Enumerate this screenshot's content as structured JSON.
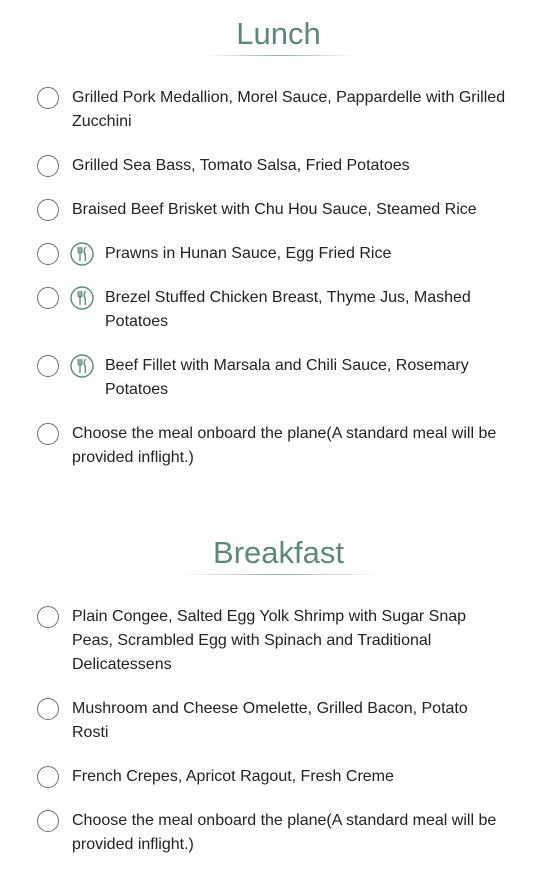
{
  "sections": [
    {
      "title": "Lunch",
      "options": [
        {
          "label": "Grilled Pork Medallion, Morel Sauce, Pappardelle with Grilled Zucchini",
          "icon": null
        },
        {
          "label": "Grilled Sea Bass, Tomato Salsa, Fried Potatoes",
          "icon": null
        },
        {
          "label": "Braised Beef Brisket with Chu Hou Sauce, Steamed Rice",
          "icon": null
        },
        {
          "label": "Prawns in Hunan Sauce, Egg Fried Rice",
          "icon": "fork-knife-icon"
        },
        {
          "label": "Brezel Stuffed Chicken Breast, Thyme Jus, Mashed Potatoes",
          "icon": "fork-knife-icon"
        },
        {
          "label": "Beef Fillet with Marsala and Chili Sauce, Rosemary Potatoes",
          "icon": "fork-knife-icon"
        },
        {
          "label": "Choose the meal onboard the plane(A standard meal will be provided inflight.)",
          "icon": null
        }
      ]
    },
    {
      "title": "Breakfast",
      "options": [
        {
          "label": "Plain Congee, Salted Egg Yolk Shrimp with Sugar Snap Peas, Scrambled Egg with Spinach and Traditional Delicatessens",
          "icon": null
        },
        {
          "label": "Mushroom and Cheese Omelette, Grilled Bacon, Potato Rosti",
          "icon": null
        },
        {
          "label": "French Crepes, Apricot Ragout, Fresh Creme",
          "icon": null
        },
        {
          "label": "Choose the meal onboard the plane(A standard meal will be provided inflight.)",
          "icon": null
        }
      ]
    }
  ],
  "colors": {
    "accent": "#5b8a78",
    "text": "#222222",
    "radio_border": "#6f6f6f"
  }
}
